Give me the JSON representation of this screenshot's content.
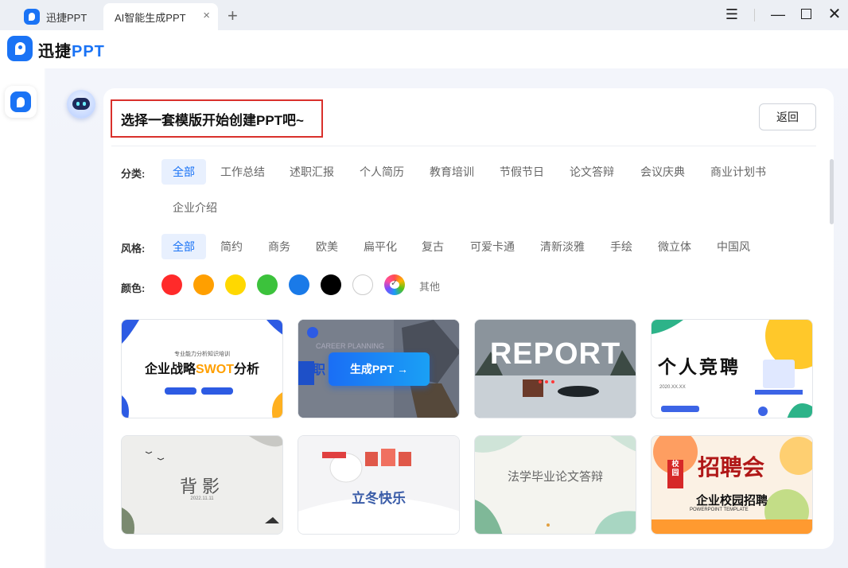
{
  "window": {
    "tabs": [
      {
        "label": "迅捷PPT"
      },
      {
        "label": "AI智能生成PPT"
      }
    ],
    "close_tab_icon": "×",
    "new_tab_icon": "+",
    "controls": {
      "menu": "☰",
      "minimize": "—",
      "close": "✕"
    }
  },
  "app": {
    "name_prefix": "迅捷",
    "name_suffix": "PPT",
    "brand_color": "#1a73f5"
  },
  "page": {
    "headline": "选择一套模版开始创建PPT吧~",
    "back_label": "返回"
  },
  "filters": {
    "category": {
      "label": "分类:",
      "options": [
        "全部",
        "工作总结",
        "述职汇报",
        "个人简历",
        "教育培训",
        "节假节日",
        "论文答辩",
        "会议庆典",
        "商业计划书",
        "企业介绍"
      ],
      "selected": "全部"
    },
    "style": {
      "label": "风格:",
      "options": [
        "全部",
        "简约",
        "商务",
        "欧美",
        "扁平化",
        "复古",
        "可爱卡通",
        "清新淡雅",
        "手绘",
        "微立体",
        "中国风"
      ],
      "selected": "全部"
    },
    "color": {
      "label": "颜色:",
      "swatches": [
        "#ff2a2a",
        "#ff9f00",
        "#ffd800",
        "#3cc23c",
        "#1a7ae8",
        "#000000",
        "#ffffff",
        "multicolor"
      ],
      "other_label": "其他"
    }
  },
  "templates": [
    {
      "title": "企业战略SWOT分析",
      "highlight": "SWOT",
      "subtitle": "专业能力分析知识培训"
    },
    {
      "title": "职",
      "overlay_button": "生成PPT →",
      "subtitle": "CAREER PLANNING"
    },
    {
      "title": "REPORT"
    },
    {
      "title": "个人竞聘",
      "subtitle": "2020.XX.XX"
    },
    {
      "title": "背影",
      "subtitle": "2022.11.11"
    },
    {
      "title": "立冬快乐"
    },
    {
      "title": "法学毕业论文答辩"
    },
    {
      "title": "招聘会",
      "badge": "校园",
      "subtitle": "企业校园招聘",
      "en_subtitle": "POWERPOINT TEMPLATE"
    }
  ]
}
